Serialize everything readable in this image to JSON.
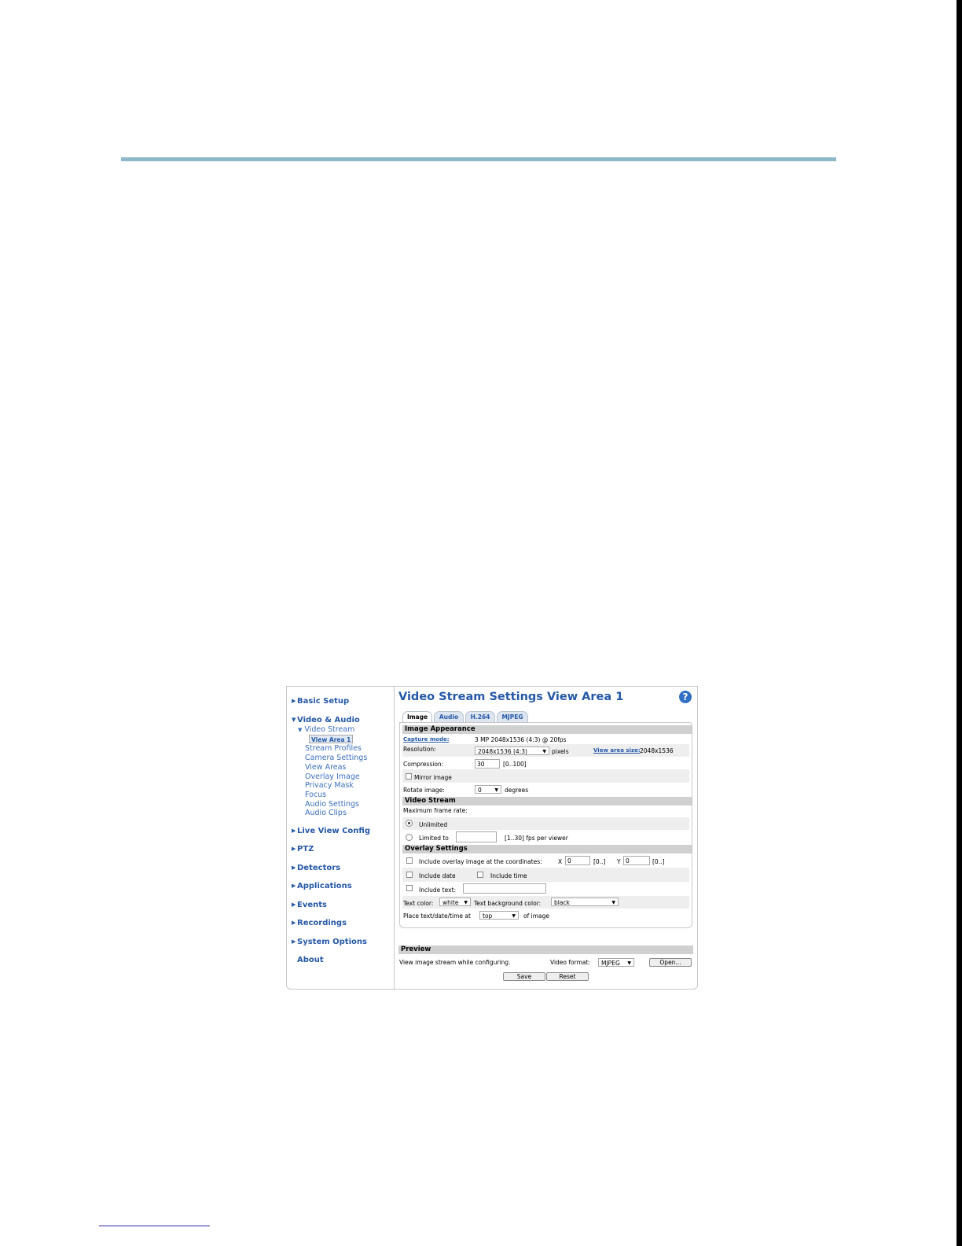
{
  "nav": {
    "basic_setup": "Basic Setup",
    "video_audio": "Video & Audio",
    "video_stream": "Video Stream",
    "view_area_1": "View Area 1",
    "stream_profiles": "Stream Profiles",
    "camera_settings": "Camera Settings",
    "view_areas": "View Areas",
    "overlay_image": "Overlay Image",
    "privacy_mask": "Privacy Mask",
    "focus": "Focus",
    "audio_settings": "Audio Settings",
    "audio_clips": "Audio Clips",
    "live_view_config": "Live View Config",
    "ptz": "PTZ",
    "detectors": "Detectors",
    "applications": "Applications",
    "events": "Events",
    "recordings": "Recordings",
    "system_options": "System Options",
    "about": "About"
  },
  "page": {
    "title": "Video Stream Settings View Area 1",
    "help_glyph": "?"
  },
  "tabs": {
    "image": "Image",
    "audio": "Audio",
    "h264": "H.264",
    "mjpeg": "MJPEG"
  },
  "image_appearance": {
    "heading": "Image Appearance",
    "capture_mode_label": "Capture mode:",
    "capture_mode_value": "3 MP 2048x1536 (4:3) @ 20fps",
    "resolution_label": "Resolution:",
    "resolution_value": "2048x1536 (4:3)",
    "pixels": "pixels",
    "view_area_size_label": "View area size:",
    "view_area_size_value": "2048x1536",
    "compression_label": "Compression:",
    "compression_value": "30",
    "compression_range": "[0..100]",
    "mirror_label": "Mirror image",
    "rotate_label": "Rotate image:",
    "rotate_value": "0",
    "degrees": "degrees"
  },
  "video_stream": {
    "heading": "Video Stream",
    "max_frame_rate": "Maximum frame rate:",
    "unlimited": "Unlimited",
    "limited_to": "Limited to",
    "fps_range": "[1..30] fps per viewer"
  },
  "overlay": {
    "heading": "Overlay Settings",
    "include_overlay": "Include overlay image at the coordinates:",
    "x_label": "X",
    "x_value": "0",
    "x_range": "[0..]",
    "y_label": "Y",
    "y_value": "0",
    "y_range": "[0..]",
    "include_date": "Include date",
    "include_time": "Include time",
    "include_text": "Include text:",
    "text_color_label": "Text color:",
    "text_color_value": "white",
    "text_bg_label": "Text background color:",
    "text_bg_value": "black",
    "place_label": "Place text/date/time at",
    "place_value": "top",
    "of_image": "of image"
  },
  "preview": {
    "heading": "Preview",
    "desc": "View image stream while configuring.",
    "video_format_label": "Video format:",
    "video_format_value": "MJPEG",
    "open_button": "Open..."
  },
  "actions": {
    "save": "Save",
    "reset": "Reset"
  },
  "colors": {
    "accent": "#2559a8",
    "rule": "#8fb8c9"
  }
}
